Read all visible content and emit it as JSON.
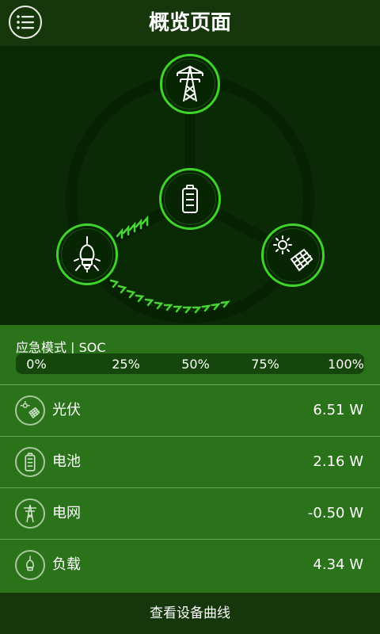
{
  "header": {
    "title": "概览页面",
    "menu_icon": "menu-list-icon"
  },
  "diagram": {
    "nodes": [
      {
        "name": "grid",
        "icon": "power-tower-icon"
      },
      {
        "name": "battery",
        "icon": "battery-icon"
      },
      {
        "name": "load",
        "icon": "lightbulb-icon"
      },
      {
        "name": "solar",
        "icon": "solar-panel-icon"
      }
    ],
    "accent_color": "#3fd42a"
  },
  "soc": {
    "title": "应急模式 | SOC",
    "ticks": [
      "0%",
      "25%",
      "50%",
      "75%",
      "100%"
    ]
  },
  "rows": [
    {
      "label": "光伏",
      "value": "6.51 W",
      "icon": "solar-panel-icon"
    },
    {
      "label": "电池",
      "value": "2.16 W",
      "icon": "battery-icon"
    },
    {
      "label": "电网",
      "value": "-0.50 W",
      "icon": "power-tower-icon"
    },
    {
      "label": "负载",
      "value": "4.34 W",
      "icon": "lightbulb-icon"
    }
  ],
  "footer": {
    "button_label": "查看设备曲线"
  },
  "colors": {
    "header_bg": "#16360c",
    "panel_bg": "#2b731b",
    "diagram_bg": "#0a2a05"
  }
}
